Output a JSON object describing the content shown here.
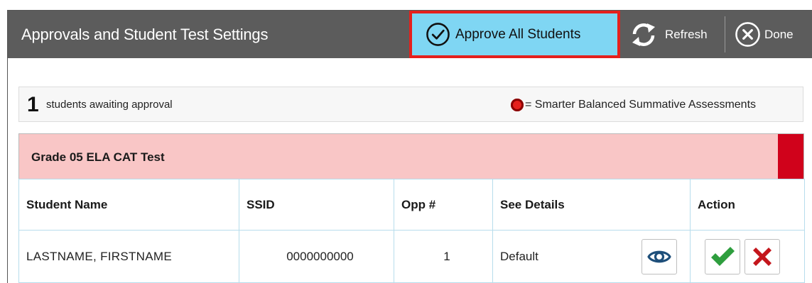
{
  "header": {
    "title": "Approvals and Student Test Settings",
    "approve_all_label": "Approve All Students",
    "refresh_label": "Refresh",
    "done_label": "Done"
  },
  "status": {
    "count": "1",
    "awaiting_text": "students awaiting approval",
    "legend_text": "= Smarter Balanced Summative Assessments"
  },
  "test": {
    "title": "Grade 05 ELA CAT Test",
    "columns": [
      "Student Name",
      "SSID",
      "Opp #",
      "See Details",
      "Action"
    ],
    "rows": [
      {
        "name": "LASTNAME, FIRSTNAME",
        "ssid": "0000000000",
        "opp": "1",
        "details": "Default"
      }
    ]
  },
  "icons": {
    "approve_all": "circle-check-icon",
    "refresh": "refresh-icon",
    "done": "circle-x-icon",
    "details": "eye-icon",
    "approve": "checkmark-icon",
    "deny": "x-icon"
  },
  "colors": {
    "header_bg": "#5c5c5c",
    "approve_all_bg": "#7fd6f3",
    "highlight_border": "#e5201c",
    "test_header_bg": "#f9c6c6",
    "summative_flag": "#d0021b",
    "approve_green": "#2e9e3e",
    "deny_red": "#c4161c",
    "details_blue": "#1e4f7a"
  }
}
